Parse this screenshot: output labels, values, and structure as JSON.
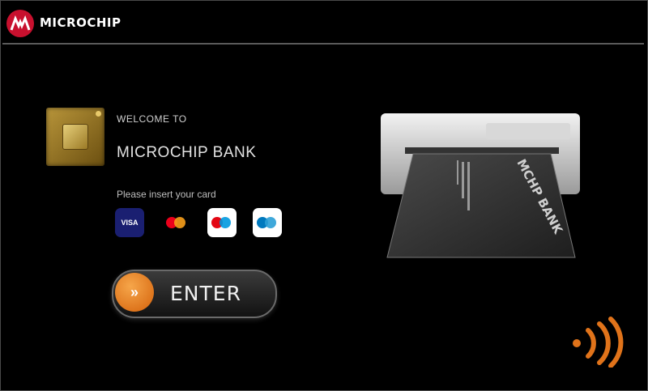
{
  "header": {
    "brand": "Microchip",
    "brand_display": "MICROCHIP"
  },
  "welcome": {
    "line1": "WELCOME TO",
    "line2": "MICROCHIP BANK",
    "instruction": "Please insert your card"
  },
  "payment_methods": [
    {
      "label": "VISA",
      "icon": "visa-icon"
    },
    {
      "label": "",
      "icon": "mastercard-icon"
    },
    {
      "label": "",
      "icon": "maestro-icon"
    },
    {
      "label": "",
      "icon": "card-icon"
    }
  ],
  "enter_button": {
    "label": "ENTER",
    "arrow": "»"
  },
  "card_text": "MCHP BANK",
  "colors": {
    "background": "#000000",
    "brand_red": "#c8102e",
    "accent_orange": "#e0731a",
    "gold": "#b8953a"
  }
}
